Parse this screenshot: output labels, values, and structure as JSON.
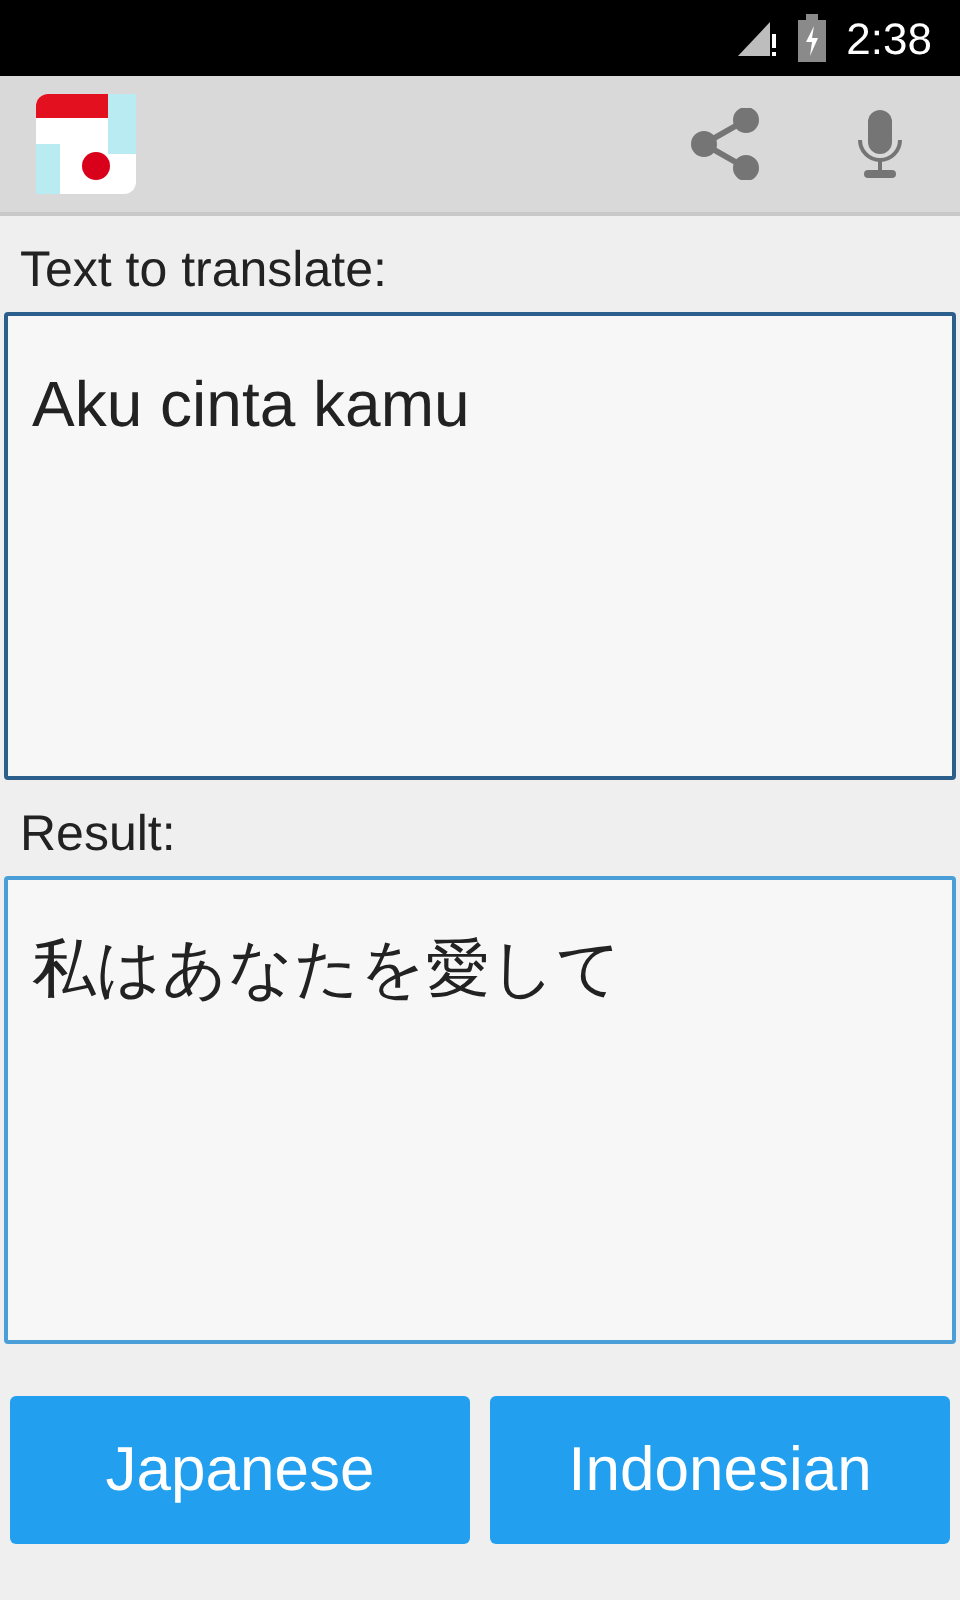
{
  "status_bar": {
    "time": "2:38"
  },
  "source": {
    "label": "Text to translate:",
    "value": "Aku cinta kamu"
  },
  "result": {
    "label": "Result:",
    "value": "私はあなたを愛して"
  },
  "buttons": [
    {
      "label": "Japanese"
    },
    {
      "label": "Indonesian"
    }
  ]
}
